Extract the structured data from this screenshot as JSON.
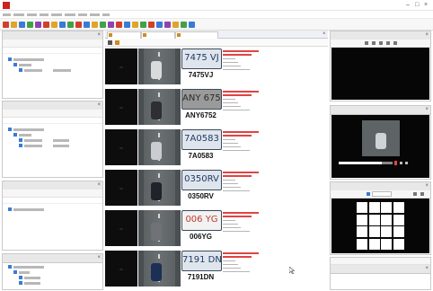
{
  "recognitions": [
    {
      "plate_crop": "7475 VJ",
      "plate": "7475VJ",
      "crop_bg": "#dfe5ec",
      "crop_color": "#1f3b66"
    },
    {
      "plate_crop": "ANY 6752",
      "plate": "ANY6752",
      "crop_bg": "#9a9a9a",
      "crop_color": "#2a2a2a"
    },
    {
      "plate_crop": "7A0583",
      "plate": "7A0583",
      "crop_bg": "#dfe5ec",
      "crop_color": "#1f3b66"
    },
    {
      "plate_crop": "0350RV",
      "plate": "0350RV",
      "crop_bg": "#dfe5ec",
      "crop_color": "#1f3b66"
    },
    {
      "plate_crop": "006 YG",
      "plate": "006YG",
      "crop_bg": "#f2f2f2",
      "crop_color": "#c0392b"
    },
    {
      "plate_crop": "7191 DN",
      "plate": "7191DN",
      "crop_bg": "#dfe5ec",
      "crop_color": "#1f3b66"
    }
  ],
  "colors": {
    "accent": "#3a7bd5",
    "alert": "#e04444",
    "menu_icon": "#cc2222"
  },
  "icons": {
    "app": "lpr-app-icon",
    "close": "close-icon",
    "cursor": "mouse-pointer-icon"
  }
}
